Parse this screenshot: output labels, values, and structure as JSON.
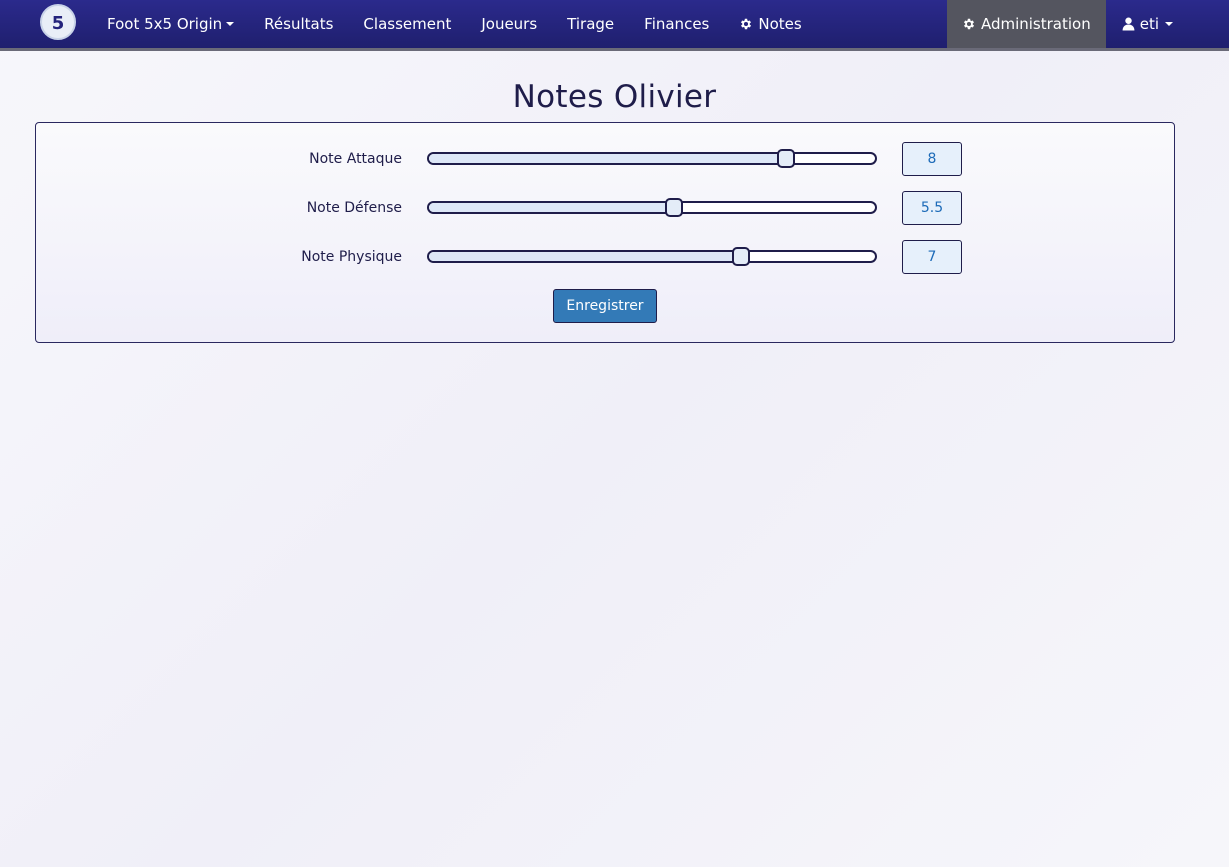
{
  "navbar": {
    "logo_icon": "5x5-logo-icon",
    "items": [
      {
        "label": "Foot 5x5 Origin",
        "has_caret": true
      },
      {
        "label": "Résultats"
      },
      {
        "label": "Classement"
      },
      {
        "label": "Joueurs"
      },
      {
        "label": "Tirage"
      },
      {
        "label": "Finances"
      },
      {
        "label": "Notes",
        "icon": "gear-icon"
      }
    ],
    "right_items": [
      {
        "label": "Administration",
        "icon": "gear-icon",
        "active": true
      },
      {
        "label": "eti",
        "icon": "user-icon",
        "has_caret": true
      }
    ]
  },
  "page": {
    "title": "Notes Olivier"
  },
  "ratings": [
    {
      "label": "Note Attaque",
      "value": "8",
      "fraction": 0.8
    },
    {
      "label": "Note Défense",
      "value": "5.5",
      "fraction": 0.55
    },
    {
      "label": "Note Physique",
      "value": "7",
      "fraction": 0.7
    }
  ],
  "form": {
    "save_label": "Enregistrer"
  },
  "colors": {
    "navbar": "#24237c",
    "active_nav": "#54555f",
    "primary_button": "#337ab7",
    "value_text": "#1d6bb8",
    "text": "#1f1d4a"
  }
}
